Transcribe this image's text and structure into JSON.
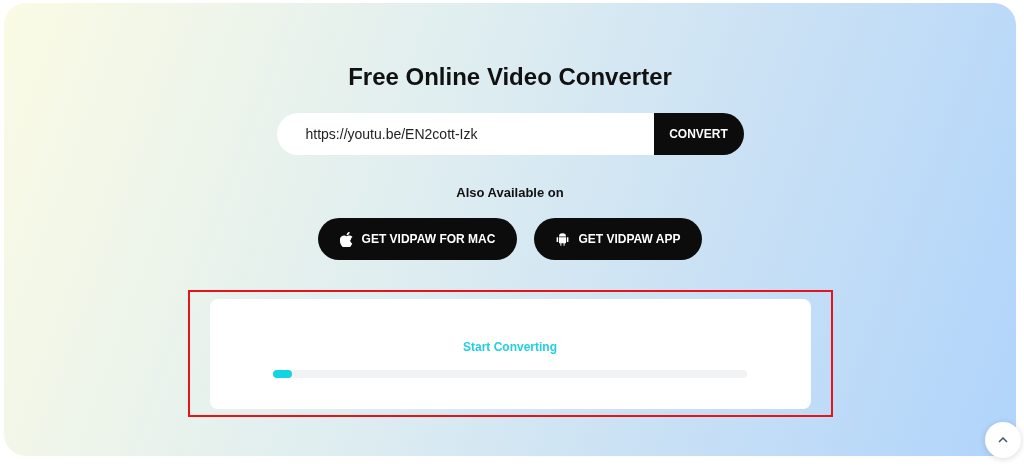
{
  "title": "Free Online Video Converter",
  "url_field": {
    "value": "https://youtu.be/EN2cott-Izk"
  },
  "convert_button": "CONVERT",
  "also_available": "Also Available on",
  "app_buttons": [
    {
      "kind": "apple",
      "label": "GET VIDPAW FOR MAC"
    },
    {
      "kind": "android",
      "label": "GET VIDPAW APP"
    }
  ],
  "progress": {
    "status": "Start Converting",
    "level": 0.04
  }
}
